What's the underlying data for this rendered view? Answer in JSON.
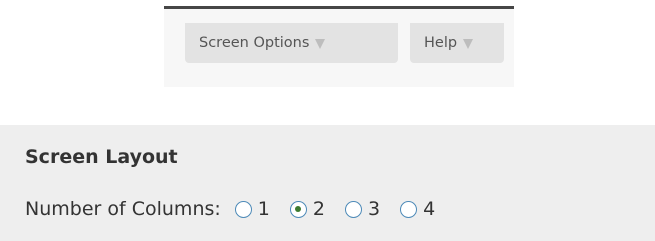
{
  "tabs": {
    "screen_options_label": "Screen Options",
    "help_label": "Help"
  },
  "screen_layout": {
    "title": "Screen Layout",
    "columns_label": "Number of Columns:",
    "options": [
      {
        "label": "1",
        "checked": false
      },
      {
        "label": "2",
        "checked": true
      },
      {
        "label": "3",
        "checked": false
      },
      {
        "label": "4",
        "checked": false
      }
    ],
    "selected_value": "2"
  },
  "colors": {
    "tab_strip_border": "#464646",
    "tab_background": "#e3e3e3",
    "panel_background": "#eeeeee",
    "radio_border": "#4d8ab8",
    "radio_dot": "#3c7a2f"
  },
  "icons": {
    "tab_arrow": "triangle-down-icon"
  }
}
